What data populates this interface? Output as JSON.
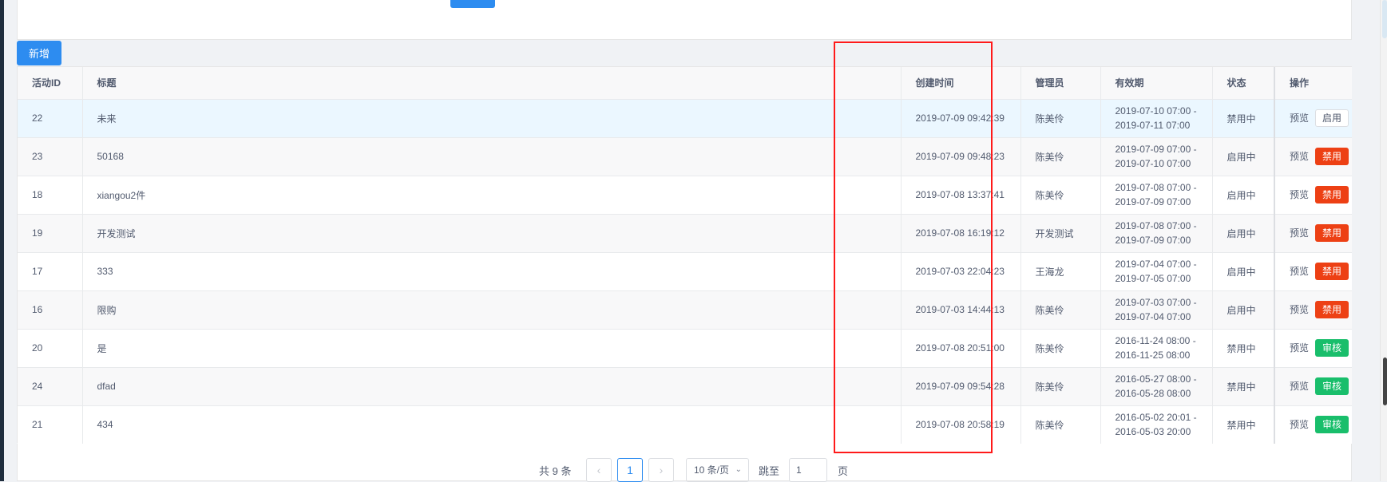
{
  "toolbar": {
    "add_label": "新增"
  },
  "table": {
    "headers": [
      "活动ID",
      "标题",
      "创建时间",
      "管理员",
      "有效期",
      "状态",
      "操作"
    ],
    "rows": [
      {
        "id": "22",
        "title": "未来",
        "created": "2019-07-09 09:42:39",
        "admin": "陈美伶",
        "valid_from": "2019-07-10 07:00 -",
        "valid_to": "2019-07-11 07:00",
        "status": "禁用中",
        "preview": "预览",
        "action": "启用",
        "action_type": "enable"
      },
      {
        "id": "23",
        "title": "50168",
        "created": "2019-07-09 09:48:23",
        "admin": "陈美伶",
        "valid_from": "2019-07-09 07:00 -",
        "valid_to": "2019-07-10 07:00",
        "status": "启用中",
        "preview": "预览",
        "action": "禁用",
        "action_type": "disable"
      },
      {
        "id": "18",
        "title": "xiangou2件",
        "created": "2019-07-08 13:37:41",
        "admin": "陈美伶",
        "valid_from": "2019-07-08 07:00 -",
        "valid_to": "2019-07-09 07:00",
        "status": "启用中",
        "preview": "预览",
        "action": "禁用",
        "action_type": "disable"
      },
      {
        "id": "19",
        "title": "开发测试",
        "created": "2019-07-08 16:19:12",
        "admin": "开发测试",
        "valid_from": "2019-07-08 07:00 -",
        "valid_to": "2019-07-09 07:00",
        "status": "启用中",
        "preview": "预览",
        "action": "禁用",
        "action_type": "disable"
      },
      {
        "id": "17",
        "title": "333",
        "created": "2019-07-03 22:04:23",
        "admin": "王海龙",
        "valid_from": "2019-07-04 07:00 -",
        "valid_to": "2019-07-05 07:00",
        "status": "启用中",
        "preview": "预览",
        "action": "禁用",
        "action_type": "disable"
      },
      {
        "id": "16",
        "title": "限购",
        "created": "2019-07-03 14:44:13",
        "admin": "陈美伶",
        "valid_from": "2019-07-03 07:00 -",
        "valid_to": "2019-07-04 07:00",
        "status": "启用中",
        "preview": "预览",
        "action": "禁用",
        "action_type": "disable"
      },
      {
        "id": "20",
        "title": "是",
        "created": "2019-07-08 20:51:00",
        "admin": "陈美伶",
        "valid_from": "2016-11-24 08:00 -",
        "valid_to": "2016-11-25 08:00",
        "status": "禁用中",
        "preview": "预览",
        "action": "审核",
        "action_type": "audit"
      },
      {
        "id": "24",
        "title": "dfad",
        "created": "2019-07-09 09:54:28",
        "admin": "陈美伶",
        "valid_from": "2016-05-27 08:00 -",
        "valid_to": "2016-05-28 08:00",
        "status": "禁用中",
        "preview": "预览",
        "action": "审核",
        "action_type": "audit"
      },
      {
        "id": "21",
        "title": "434",
        "created": "2019-07-08 20:58:19",
        "admin": "陈美伶",
        "valid_from": "2016-05-02 20:01 -",
        "valid_to": "2016-05-03 20:00",
        "status": "禁用中",
        "preview": "预览",
        "action": "审核",
        "action_type": "audit"
      }
    ]
  },
  "pagination": {
    "total_text": "共 9 条",
    "prev_icon": "‹",
    "current_page": "1",
    "next_icon": "›",
    "page_size": "10 条/页",
    "jump_label": "跳至",
    "jump_value": "1",
    "page_suffix": "页"
  },
  "colors": {
    "primary": "#2d8cf0",
    "danger": "#ed4014",
    "success": "#19be6b",
    "highlight_box": "#ff1a1a"
  }
}
